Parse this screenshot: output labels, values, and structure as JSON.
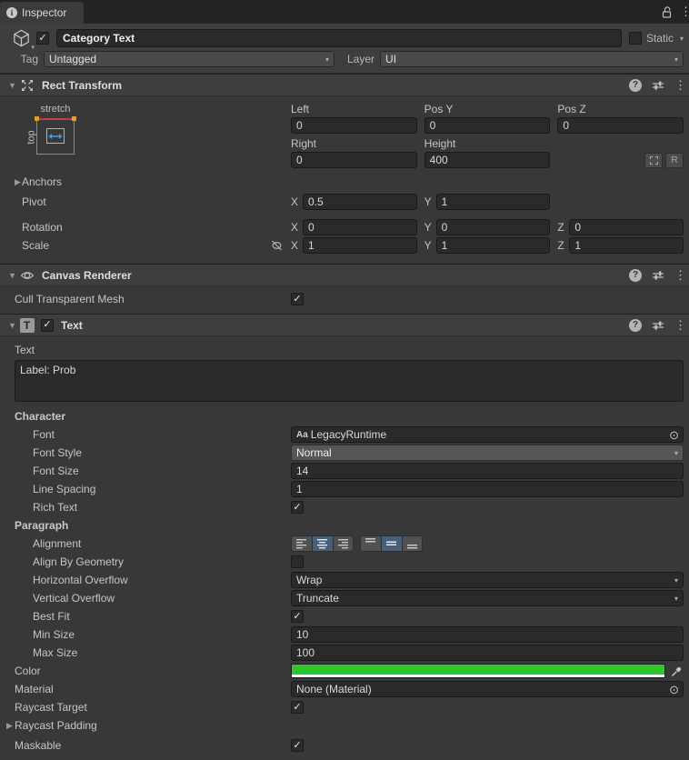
{
  "glyphs": {
    "check": "✓",
    "dropdown_arrow": "▾",
    "foldout_open": "▼",
    "foldout_closed": "▶",
    "kebab": "⋮",
    "picker": "⊙",
    "aa": "Aa",
    "info": "i",
    "help": "?",
    "r_button": "R",
    "t_icon": "T"
  },
  "colors": {
    "text_color_swatch": "#2FC52F",
    "alignment_selected": "#46607C"
  },
  "tab_bar": {
    "title": "Inspector"
  },
  "game_object": {
    "name": "Category Text",
    "active_checked": true,
    "static_label": "Static",
    "static_checked": false,
    "tag_label": "Tag",
    "tag_value": "Untagged",
    "layer_label": "Layer",
    "layer_value": "UI"
  },
  "rect_transform": {
    "title": "Rect Transform",
    "anchor_preset": {
      "horizontal": "stretch",
      "vertical": "top"
    },
    "axis": {
      "x": "X",
      "y": "Y",
      "z": "Z"
    },
    "left": {
      "label": "Left",
      "value": "0"
    },
    "pos_y": {
      "label": "Pos Y",
      "value": "0"
    },
    "pos_z": {
      "label": "Pos Z",
      "value": "0"
    },
    "right": {
      "label": "Right",
      "value": "0"
    },
    "height": {
      "label": "Height",
      "value": "400"
    },
    "anchors_label": "Anchors",
    "pivot": {
      "label": "Pivot",
      "x": "0.5",
      "y": "1"
    },
    "rotation": {
      "label": "Rotation",
      "x": "0",
      "y": "0",
      "z": "0"
    },
    "scale": {
      "label": "Scale",
      "x": "1",
      "y": "1",
      "z": "1"
    }
  },
  "canvas_renderer": {
    "title": "Canvas Renderer",
    "cull_transparent_mesh": {
      "label": "Cull Transparent Mesh",
      "checked": true
    }
  },
  "text_component": {
    "title": "Text",
    "enabled_checked": true,
    "text_section_label": "Text",
    "text_value": "Label: Prob",
    "character_label": "Character",
    "font": {
      "label": "Font",
      "value": "LegacyRuntime"
    },
    "font_style": {
      "label": "Font Style",
      "value": "Normal"
    },
    "font_size": {
      "label": "Font Size",
      "value": "14"
    },
    "line_spacing": {
      "label": "Line Spacing",
      "value": "1"
    },
    "rich_text": {
      "label": "Rich Text",
      "checked": true
    },
    "paragraph_label": "Paragraph",
    "alignment": {
      "label": "Alignment",
      "horizontal_selected": "center",
      "vertical_selected": "middle"
    },
    "align_by_geometry": {
      "label": "Align By Geometry",
      "checked": false
    },
    "horizontal_overflow": {
      "label": "Horizontal Overflow",
      "value": "Wrap"
    },
    "vertical_overflow": {
      "label": "Vertical Overflow",
      "value": "Truncate"
    },
    "best_fit": {
      "label": "Best Fit",
      "checked": true
    },
    "min_size": {
      "label": "Min Size",
      "value": "10"
    },
    "max_size": {
      "label": "Max Size",
      "value": "100"
    },
    "color": {
      "label": "Color",
      "hex": "#2FC52F",
      "alpha_full": true
    },
    "material": {
      "label": "Material",
      "value": "None (Material)"
    },
    "raycast_target": {
      "label": "Raycast Target",
      "checked": true
    },
    "raycast_padding": {
      "label": "Raycast Padding"
    },
    "maskable": {
      "label": "Maskable",
      "checked": true
    }
  }
}
